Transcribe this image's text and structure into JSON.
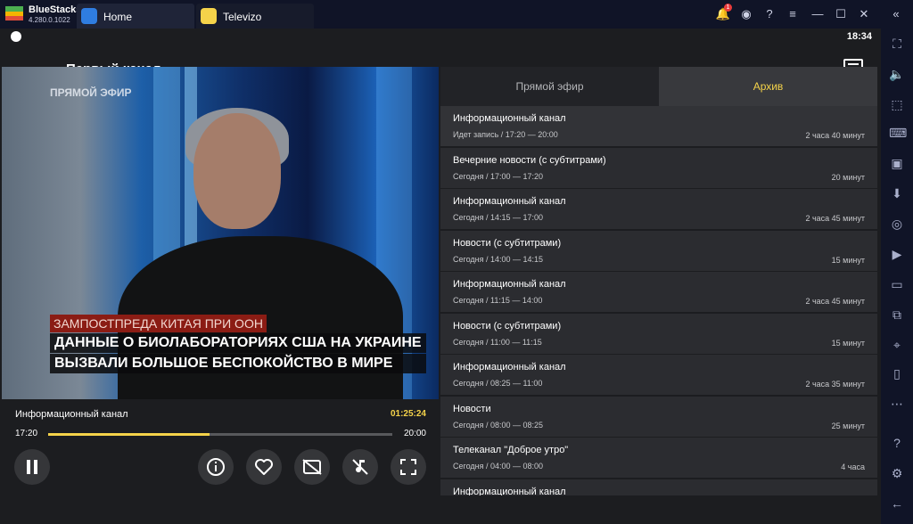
{
  "window": {
    "app_name": "BlueStacks",
    "app_version": "4.280.0.1022",
    "tabs": [
      {
        "label": "Home",
        "icon": "home-icon"
      },
      {
        "label": "Televizo",
        "icon": "televizo-icon"
      }
    ],
    "notification_count": "1"
  },
  "status": {
    "time": "18:34"
  },
  "appbar": {
    "title": "Первый канал"
  },
  "video": {
    "live_label": "ПРЯМОЙ ЭФИР",
    "ticker_top": "ЗАМПОСТПРЕДА КИТАЯ ПРИ ООН",
    "ticker_line1": "ДАННЫЕ О БИОЛАБОРАТОРИЯХ США НА УКРАИНЕ",
    "ticker_line2": "ВЫЗВАЛИ БОЛЬШОЕ БЕСПОКОЙСТВО В МИРЕ"
  },
  "player": {
    "now_title": "Информационный канал",
    "duration": "01:25:24",
    "start": "17:20",
    "end": "20:00",
    "progress": 0.47
  },
  "tabs": {
    "live": "Прямой эфир",
    "archive": "Архив",
    "active": "archive"
  },
  "programs": [
    {
      "title": "Информационный канал",
      "time": "Идет запись / 17:20 — 20:00",
      "length": "2 часа 40 минут"
    },
    {
      "title": "Вечерние новости (с субтитрами)",
      "time": "Сегодня / 17:00 — 17:20",
      "length": "20 минут"
    },
    {
      "title": "Информационный канал",
      "time": "Сегодня / 14:15 — 17:00",
      "length": "2 часа 45 минут"
    },
    {
      "title": "Новости (с субтитрами)",
      "time": "Сегодня / 14:00 — 14:15",
      "length": "15 минут"
    },
    {
      "title": "Информационный канал",
      "time": "Сегодня / 11:15 — 14:00",
      "length": "2 часа 45 минут"
    },
    {
      "title": "Новости (с субтитрами)",
      "time": "Сегодня / 11:00 — 11:15",
      "length": "15 минут"
    },
    {
      "title": "Информационный канал",
      "time": "Сегодня / 08:25 — 11:00",
      "length": "2 часа 35 минут"
    },
    {
      "title": "Новости",
      "time": "Сегодня / 08:00 — 08:25",
      "length": "25 минут"
    },
    {
      "title": "Телеканал \"Доброе утро\"",
      "time": "Сегодня / 04:00 — 08:00",
      "length": "4 часа"
    },
    {
      "title": "Информационный канал",
      "time": "",
      "length": ""
    }
  ],
  "colors": {
    "accent": "#f5d34a",
    "bg": "#1c1d20",
    "row": "#2b2c30",
    "titlebar": "#101427"
  }
}
